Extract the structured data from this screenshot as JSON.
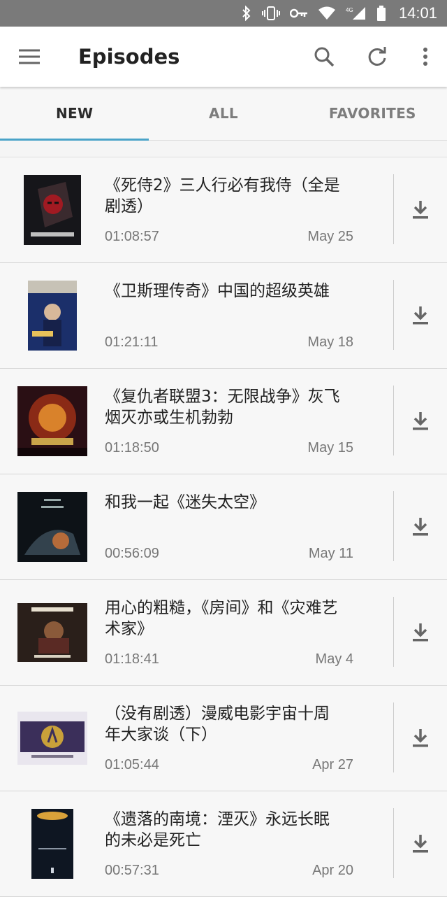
{
  "status_bar": {
    "time": "14:01",
    "network": "4G",
    "signal_icons": [
      "bluetooth-icon",
      "vibrate-icon",
      "key-icon",
      "wifi-icon",
      "cell-signal-icon",
      "battery-icon"
    ]
  },
  "app_bar": {
    "title": "Episodes",
    "icons": [
      "menu-icon",
      "search-icon",
      "refresh-icon",
      "more-vert-icon"
    ]
  },
  "tabs": [
    {
      "label": "NEW",
      "active": true
    },
    {
      "label": "ALL",
      "active": false
    },
    {
      "label": "FAVORITES",
      "active": false
    }
  ],
  "colors": {
    "accent": "#4aa3c8",
    "status_bar": "#7a7a7a",
    "text_secondary": "#777777"
  },
  "episodes": [
    {
      "title": "《死侍2》三人行必有我侍（全是剧透）",
      "duration": "01:08:57",
      "date": "May 25",
      "poster": "deadpool-poster"
    },
    {
      "title": "《卫斯理传奇》中国的超级英雄",
      "duration": "01:21:11",
      "date": "May 18",
      "poster": "wisely-poster"
    },
    {
      "title": "《复仇者联盟3：无限战争》灰飞烟灭亦或生机勃勃",
      "duration": "01:18:50",
      "date": "May 15",
      "poster": "avengers-infinity-war-poster"
    },
    {
      "title": "和我一起《迷失太空》",
      "duration": "00:56:09",
      "date": "May 11",
      "poster": "lost-in-space-poster"
    },
    {
      "title": "用心的粗糙，《房间》和《灾难艺术家》",
      "duration": "01:18:41",
      "date": "May 4",
      "poster": "spirit-awards-poster"
    },
    {
      "title": "（没有剧透）漫威电影宇宙十周年大家谈（下）",
      "duration": "01:05:44",
      "date": "Apr 27",
      "poster": "marvel-10-years-poster"
    },
    {
      "title": "《遗落的南境：湮灭》永远长眠的未必是死亡",
      "duration": "00:57:31",
      "date": "Apr 20",
      "poster": "annihilation-poster"
    }
  ]
}
